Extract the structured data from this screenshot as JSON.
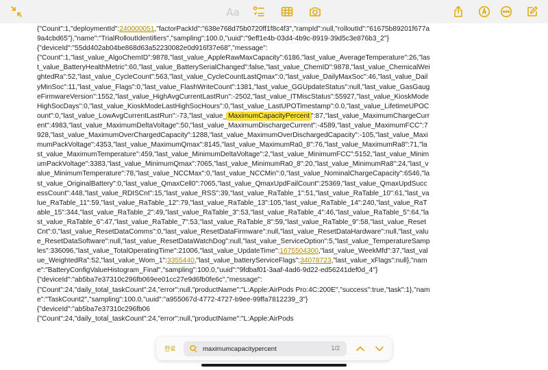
{
  "toolbar": {
    "format_label": "Aa",
    "icons": [
      "collapse-arrows-icon",
      "checklist-icon",
      "table-icon",
      "camera-icon",
      "share-icon",
      "markup-pen-icon",
      "more-ellipsis-icon",
      "compose-icon"
    ]
  },
  "note": {
    "l1": "{\"Count\":1,\"deploymentId\":",
    "l1_link": "240000051",
    "l1_rest": ",\"factorPackId\":\"638e768d75b0720ff1f8c4f3\",\"rampId\":null,\"rolloutId\":\"61675b89201f677a9a4cbd65\"},\"name\":\"TrialRolloutIdentifiers\",\"sampling\":100.0,\"uuid\":\"9eff1e4b-03d4-4b9c-8919-39d5c3e876b3_2\"}",
    "l2": "{\"deviceId\":\"55dd402ab04be868d63a52230082e0d916f37e68\",\"message\":",
    "l3_a": "{\"Count\":1,\"last_value_AlgoChemID\":9878,\"last_value_AppleRawMaxCapacity\":6186,\"last_value_AverageTemperature\":26,\"last_value_BatteryHealthMetric\":60,\"last_value_BatterySerialChanged\":false,\"last_value_ChemID\":9878,\"last_value_ChemicalWeightedRa\":52,\"last_value_CycleCount\":563,\"last_value_CycleCountLastQmax\":0,\"last_value_DailyMaxSoc\":46,\"last_value_DailyMinSoc\":11,\"last_value_Flags\":0,\"last_value_FlashWriteCount\":1381,\"last_value_GGUpdateStatus\":null,\"last_value_GasGaugeFirmwareVersion\":1552,\"last_value_HighAvgCurrentLastRun\":-2502,\"last_value_ITMiscStatus\":55927,\"last_value_KioskModeHighSocDays\":0,\"last_value_KioskModeLastHighSocHours\":0,\"last_value_LastUPOTimestamp\":0.0,\"last_value_LifetimeUPOCount\":0,\"last_value_LowAvgCurrentLastRun\":-73,\"last_value_",
    "highlight": "MaximumCapacityPercent",
    "l3_b": "\":87,\"last_value_MaximumChargeCurrent\":4983,\"last_value_MaximumDeltaVoltage\":50,\"last_value_MaximumDischargeCurrent\":-4589,\"last_value_MaximumFCC\":7928,\"last_value_MaximumOverChargedCapacity\":1288,\"last_value_MaximumOverDischargedCapacity\":-105,\"last_value_MaximumPackVoltage\":4353,\"last_value_MaximumQmax\":8145,\"last_value_MaximumRa0_8\":76,\"last_value_MaximumRa8\":71,\"last_value_MaximumTemperature\":459,\"last_value_MinimumDeltaVoltage\":2,\"last_value_MinimumFCC\":5152,\"last_value_MinimumPackVoltage\":3383,\"last_value_MinimumQmax\":7065,\"last_value_MinimumRa0_8\":20,\"last_value_MinimumRa8\":24,\"last_value_MinimumTemperature\":78,\"last_value_NCCMax\":0,\"last_value_NCCMin\":0,\"last_value_NominalChargeCapacity\":6546,\"last_value_OriginalBattery\":0,\"last_value_QmaxCell0\":7065,\"last_value_QmaxUpdFailCount\":25369,\"last_value_QmaxUpdSuccessCount\":448,\"last_value_RDISCnt\":15,\"last_value_RSS\":39,\"last_value_RaTable_1\":51,\"last_value_RaTable_10\":61,\"last_value_RaTable_11\":59,\"last_value_RaTable_12\":79,\"last_value_RaTable_13\":105,\"last_value_RaTable_14\":240,\"last_value_RaTable_15\":344,\"last_value_RaTable_2\":49,\"last_value_RaTable_3\":53,\"last_value_RaTable_4\":46,\"last_value_RaTable_5\":64,\"last_value_RaTable_6\":47,\"last_value_RaTable_7\":53,\"last_value_RaTable_8\":59,\"last_value_RaTable_9\":58,\"last_value_ResetCnt\":0,\"last_value_ResetDataComms\":0,\"last_value_ResetDataFirmware\":null,\"last_value_ResetDataHardware\":null,\"last_value_ResetDataSoftware\":null,\"last_value_ResetDataWatchDog\":null,\"last_value_ServiceOption\":5,\"last_value_TemperatureSamples\":336096,\"last_value_TotalOperatingTime\":21006,\"last_value_UpdateTime\":",
    "link_update": "1675504300",
    "l3_c": ",\"last_value_WeekMfd\":37,\"last_value_WeightedRa\":52,\"last_value_Wom_1\":",
    "link_wom": "3355440",
    "l3_d": ",\"last_value_batteryServiceFlags\":",
    "link_flags": "34078723",
    "l3_e": ",\"last_value_xFlags\":null},\"name\":\"BatteryConfigValueHistogram_Final\",\"sampling\":100.0,\"uuid\":\"9fdbaf01-3aaf-4ad6-9d22-ed56241def0d_4\"}",
    "l4": "{\"deviceId\":\"ab5ba7e37310c296fb069ee01cc27e9d6fb0fe6c\",\"message\":",
    "l5": "{\"Count\":24,\"daily_total_taskCount\":24,\"error\":null,\"productName\":\"L:Apple:AirPods Pro:4C:200E\",\"success\":true,\"task\":1},\"name\":\"TaskCount2\",\"sampling\":100.0,\"uuid\":\"a955067d-4772-4727-b9ee-99ffa7812239_3\"}",
    "l6": "{\"deviceId\":\"ab5ba7e37310c296fb06",
    "l7": "{\"Count\":24,\"daily_total_taskCount\":24,\"error\":null,\"productName\":\"L:Apple:AirPods"
  },
  "find": {
    "done_label": "완료",
    "query": "maximumcapacitypercent",
    "count": "1/2"
  }
}
